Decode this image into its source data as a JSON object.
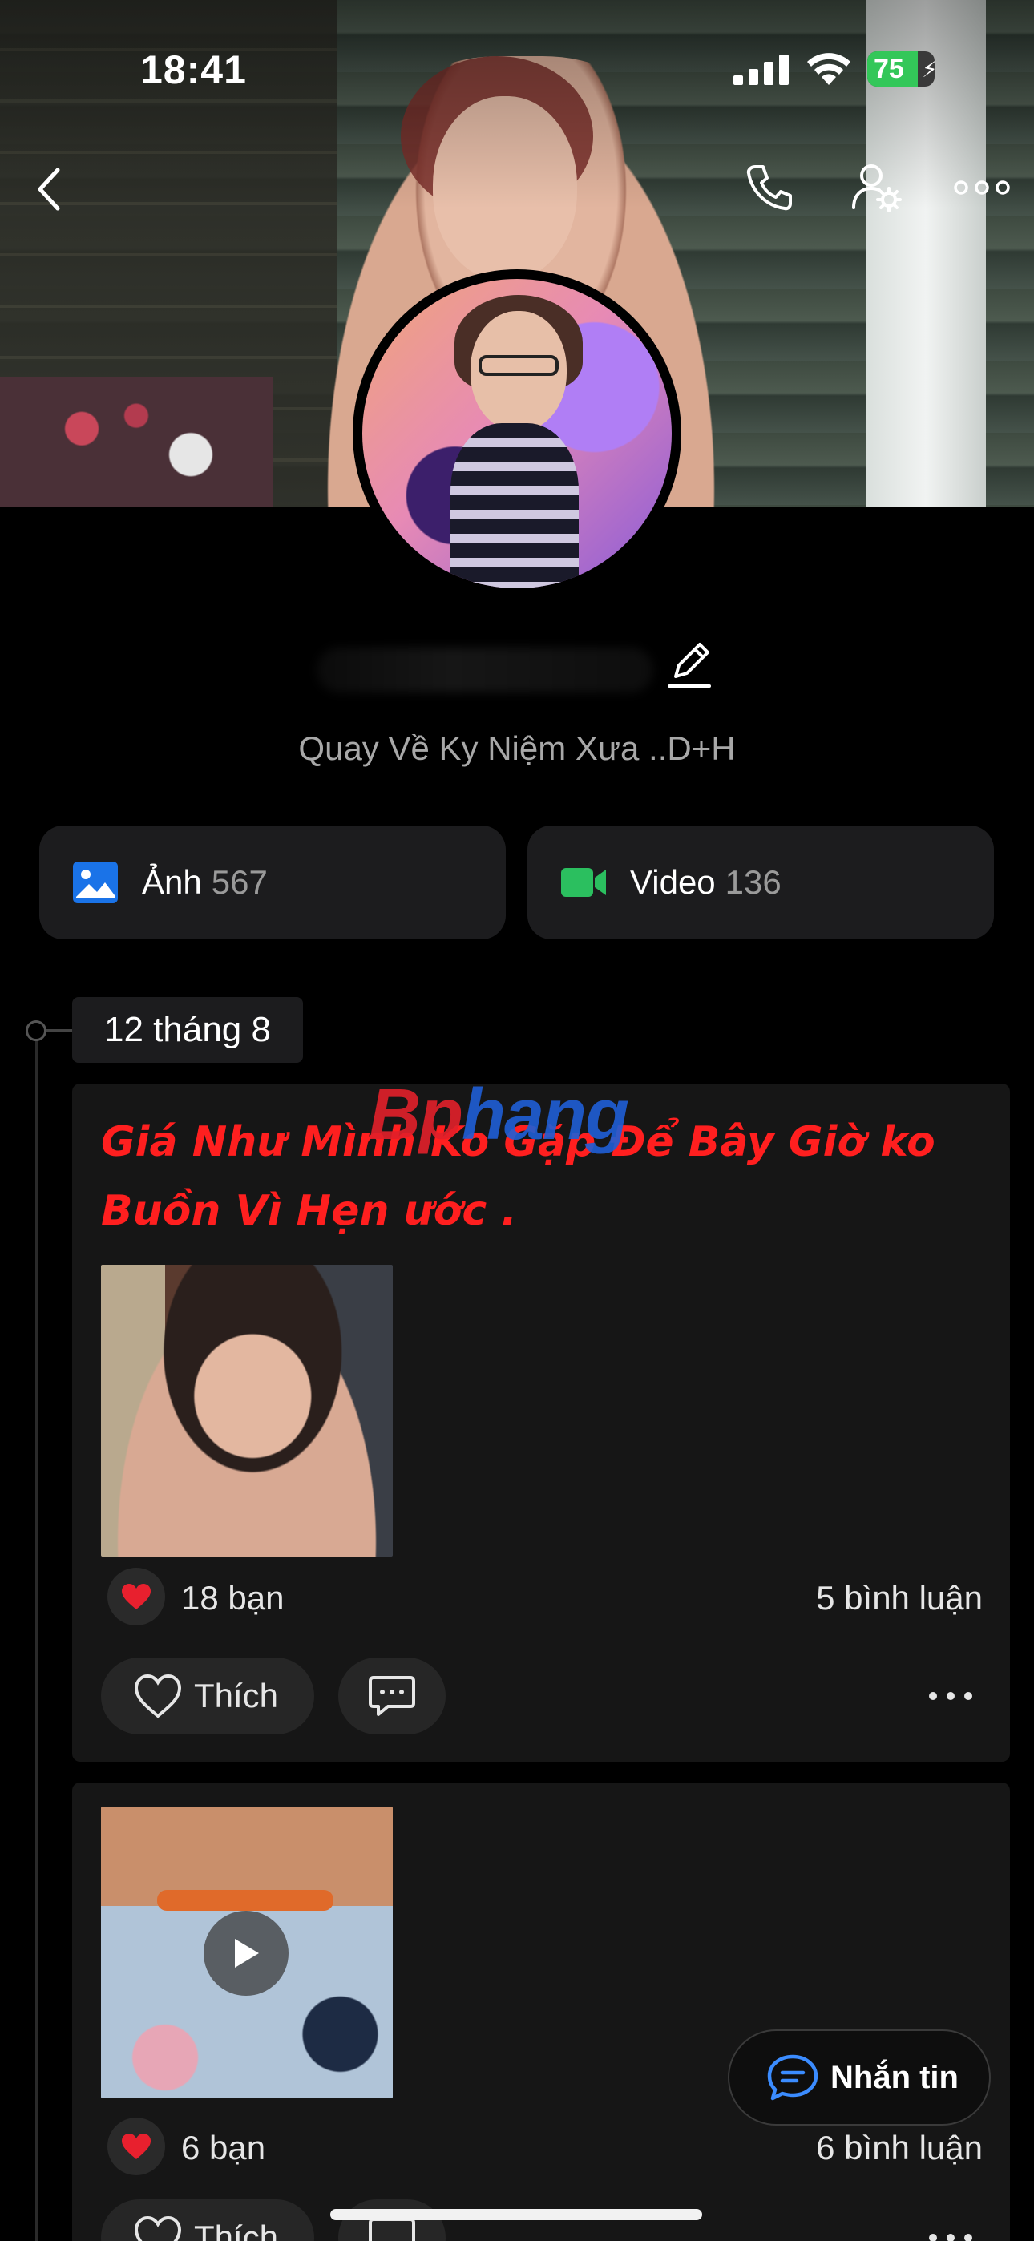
{
  "status_bar": {
    "time": "18:41",
    "battery": "75",
    "battery_level": 0.75
  },
  "profile": {
    "name": "",
    "bio": "Quay Về Ky Niệm Xưa ..D+H"
  },
  "albums": [
    {
      "label": "Ảnh",
      "count": "567",
      "icon": "image-icon",
      "color": "#1a73e8"
    },
    {
      "label": "Video",
      "count": "136",
      "icon": "video-camera-icon",
      "color": "#2bbf5f"
    }
  ],
  "timeline": {
    "date": "12 tháng 8",
    "posts": [
      {
        "text": "Giá Như Mình Ko Gặp Để Bây Giờ ko Buồn Vì Hẹn ước .",
        "media": "photo",
        "likes": "18 bạn",
        "comments": "5 bình luận",
        "like_label": "Thích"
      },
      {
        "text": "",
        "media": "video",
        "likes": "6 bạn",
        "comments": "6 bình luận",
        "like_label": "Thích"
      }
    ]
  },
  "watermark": {
    "part1": "Bp",
    "part2": "hang"
  },
  "fab": {
    "label": "Nhắn tin"
  },
  "colors": {
    "accent": "#1a73e8",
    "post_text": "#ff1f1f",
    "heart": "#e8202e",
    "battery": "#33c759"
  }
}
